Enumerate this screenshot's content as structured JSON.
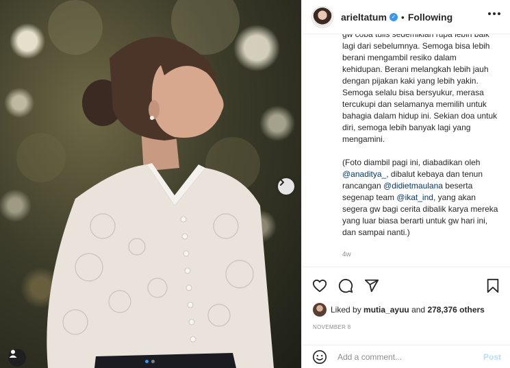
{
  "header": {
    "username": "arieltatum",
    "bullet": "•",
    "follow_status": "Following"
  },
  "caption": {
    "paragraph1": "gw coba tulis sedemikian rupa lebih baik lagi dari sebelumnya. Semoga bisa lebih berani mengambil resiko dalam kehidupan. Berani melangkah lebih jauh dengan pijakan kaki yang lebih yakin. Semoga selalu bisa bersyukur, merasa tercukupi dan selamanya memilih untuk bahagia dalam hidup ini. Sekian doa untuk diri, semoga lebih banyak lagi yang mengamini.",
    "p2_part1": "(Foto diambil pagi ini, diabadikan oleh ",
    "mention1": "@anaditya_",
    "p2_part2": ", dibalut kebaya dan tenun rancangan ",
    "mention2": "@didietmaulana",
    "p2_part3": " beserta segenap team ",
    "mention3": "@ikat_ind",
    "p2_part4": ", yang akan segera gw bagi cerita dibalik karya mereka yang luar biasa berarti untuk gw hari ini, dan sampai nanti.)",
    "time_ago": "4w"
  },
  "likes": {
    "prefix": "Liked by ",
    "liker": "mutia_ayuu",
    "connector": " and ",
    "others": "278,376 others"
  },
  "date": "NOVEMBER 8",
  "comment": {
    "placeholder": "Add a comment...",
    "post_label": "Post"
  },
  "carousel": {
    "total_slides": 2,
    "current_slide": 1
  },
  "icons": [
    "chevron-right-icon",
    "user-tag-icon",
    "verified-badge-icon",
    "more-options-icon",
    "heart-icon",
    "comment-icon",
    "share-icon",
    "bookmark-icon",
    "emoji-icon"
  ],
  "colors": {
    "link": "#00376b",
    "verified": "#3897f0",
    "post_disabled": "#b2dffc",
    "muted": "#8e8e8e"
  }
}
